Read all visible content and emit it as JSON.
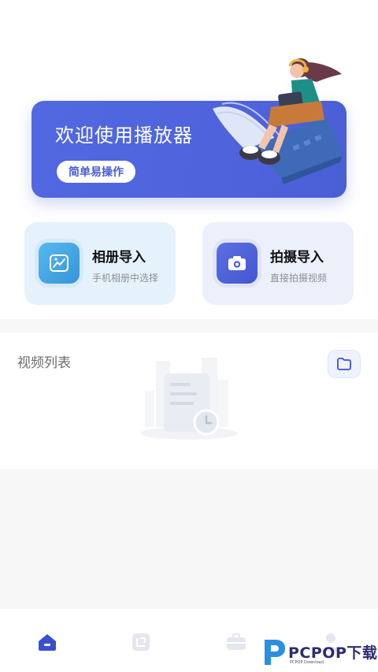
{
  "banner": {
    "title": "欢迎使用播放器",
    "button_label": "简单易操作"
  },
  "cards": [
    {
      "title": "相册导入",
      "subtitle": "手机相册中选择",
      "icon": "image-icon"
    },
    {
      "title": "拍摄导入",
      "subtitle": "直接拍摄视频",
      "icon": "camera-icon"
    }
  ],
  "video_list": {
    "title": "视频列表",
    "folder_icon": "folder-icon",
    "empty_icon": "empty-document-icon"
  },
  "bottom_nav": {
    "items": [
      {
        "icon": "home-icon",
        "active": true
      },
      {
        "icon": "crop-icon",
        "active": false
      },
      {
        "icon": "toolbox-icon",
        "active": false
      },
      {
        "icon": "profile-icon",
        "active": false
      }
    ]
  },
  "watermark": {
    "text": "PCPOP下载",
    "small": "PCPOP Download"
  },
  "colors": {
    "accent": "#4f64dc",
    "album_card": "#e6f2fb",
    "shoot_card": "#ecf0fb",
    "nav_active": "#3a4fd0",
    "nav_inactive": "#e4e7ef"
  }
}
